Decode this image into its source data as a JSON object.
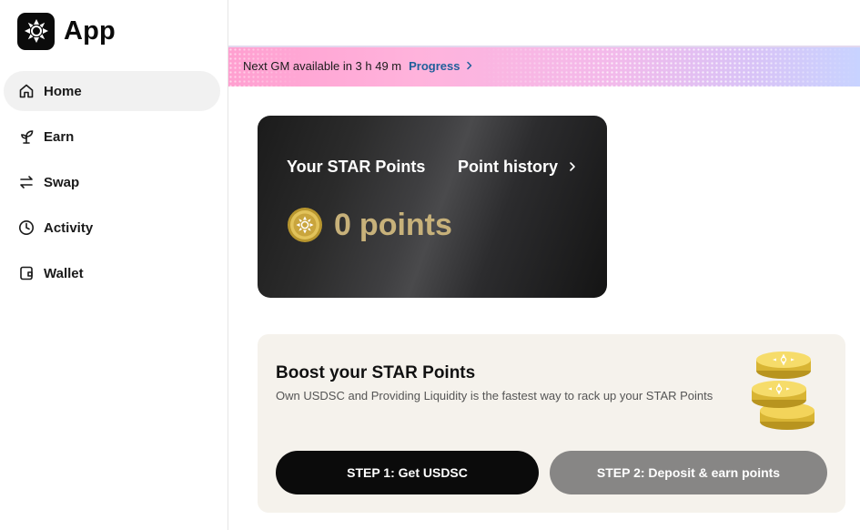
{
  "brand": {
    "name": "App",
    "logo_icon": "star-badge-icon"
  },
  "sidebar": {
    "items": [
      {
        "label": "Home",
        "icon": "home-icon",
        "active": true
      },
      {
        "label": "Earn",
        "icon": "sprout-icon",
        "active": false
      },
      {
        "label": "Swap",
        "icon": "swap-arrows-icon",
        "active": false
      },
      {
        "label": "Activity",
        "icon": "clock-icon",
        "active": false
      },
      {
        "label": "Wallet",
        "icon": "wallet-icon",
        "active": false
      }
    ]
  },
  "banner": {
    "text": "Next GM available in 3 h 49 m",
    "link_label": "Progress"
  },
  "points_card": {
    "title": "Your STAR Points",
    "history_label": "Point history",
    "value": "0",
    "unit": "points"
  },
  "boost": {
    "title": "Boost your STAR Points",
    "description": "Own USDSC and Providing Liquidity is the fastest way to rack up your STAR Points",
    "step1_label": "STEP 1: Get USDSC",
    "step2_label": "STEP 2: Deposit & earn points"
  },
  "colors": {
    "accent_link": "#1f5f9a",
    "points_gold": "#c7b17a",
    "primary_button": "#0b0b0b",
    "disabled_button": "#878685",
    "boost_bg": "#f5f2ec"
  }
}
